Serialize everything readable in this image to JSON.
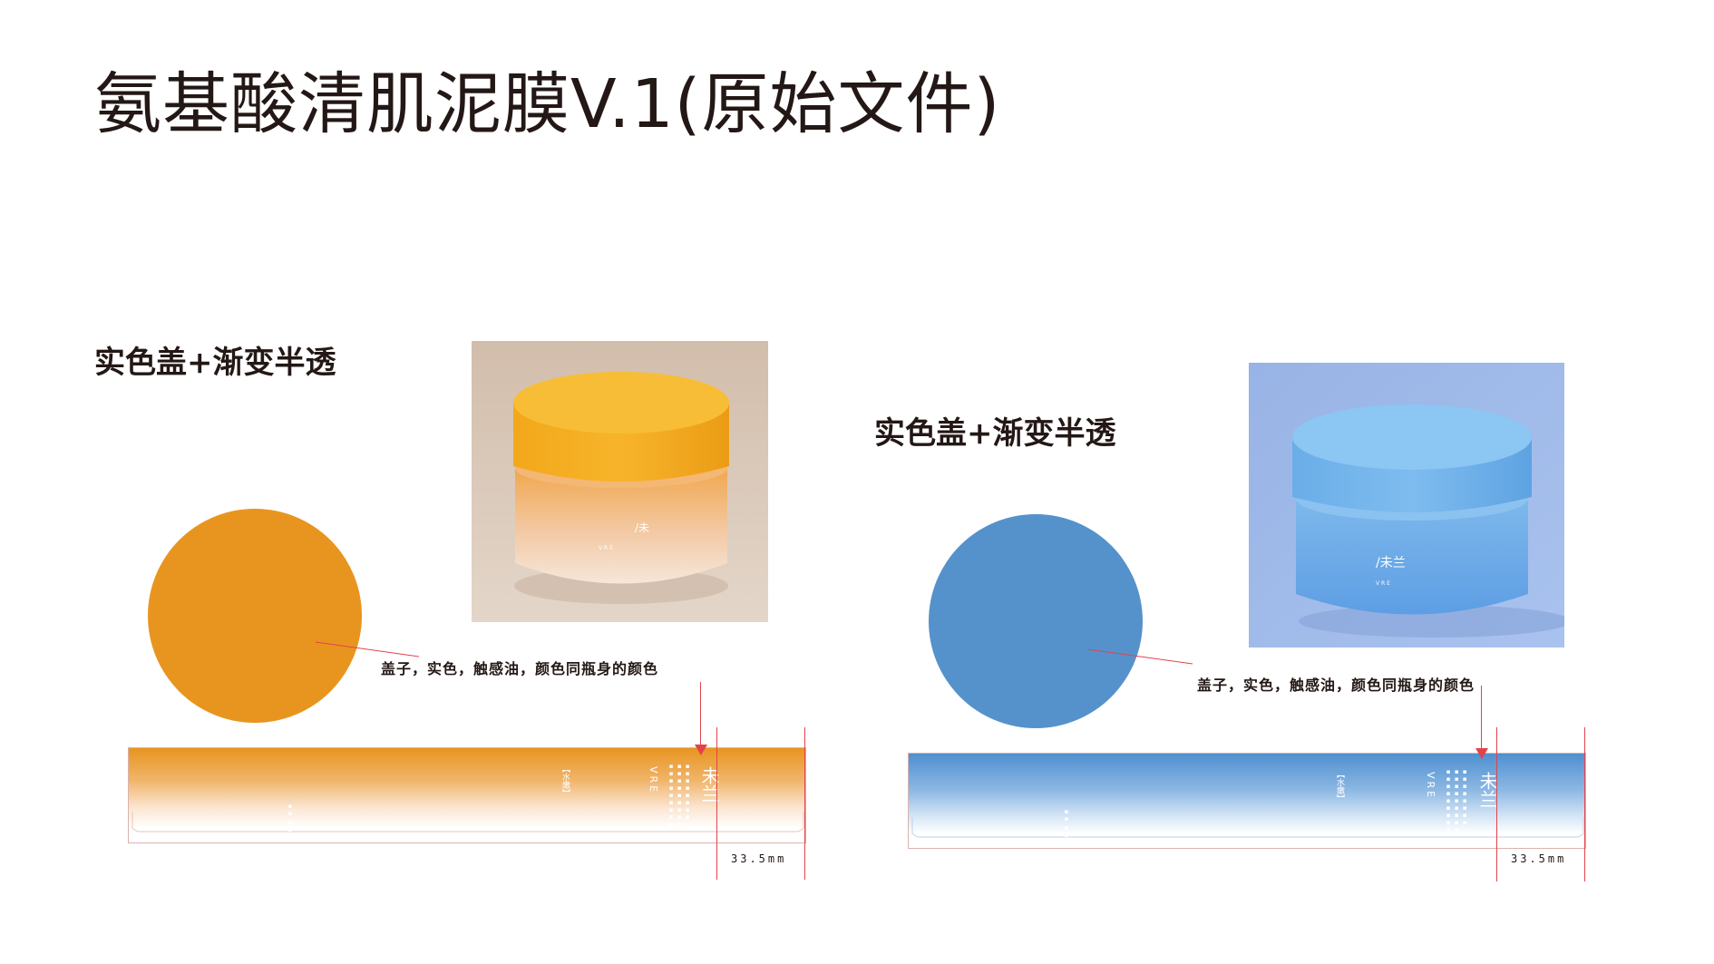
{
  "page": {
    "title": "氨基酸清肌泥膜V.1(原始文件)"
  },
  "colors": {
    "orange": "#e8951f",
    "blue": "#5592cb",
    "guide_red": "#e3424b"
  },
  "variants": [
    {
      "title": "实色盖+渐变半透",
      "annotation": "盖子，实色，触感油，颜色同瓶身的颜色",
      "dimension": "33.5mm",
      "swatch_color": "#e8951f",
      "label_brand": "VRE",
      "label_logo": "未兰",
      "label_badge": "【水嫩】"
    },
    {
      "title": "实色盖+渐变半透",
      "annotation": "盖子，实色，触感油，颜色同瓶身的颜色",
      "dimension": "33.5mm",
      "swatch_color": "#5592cb",
      "label_brand": "VRE",
      "label_logo": "未兰",
      "label_badge": "【水嫩】"
    }
  ]
}
